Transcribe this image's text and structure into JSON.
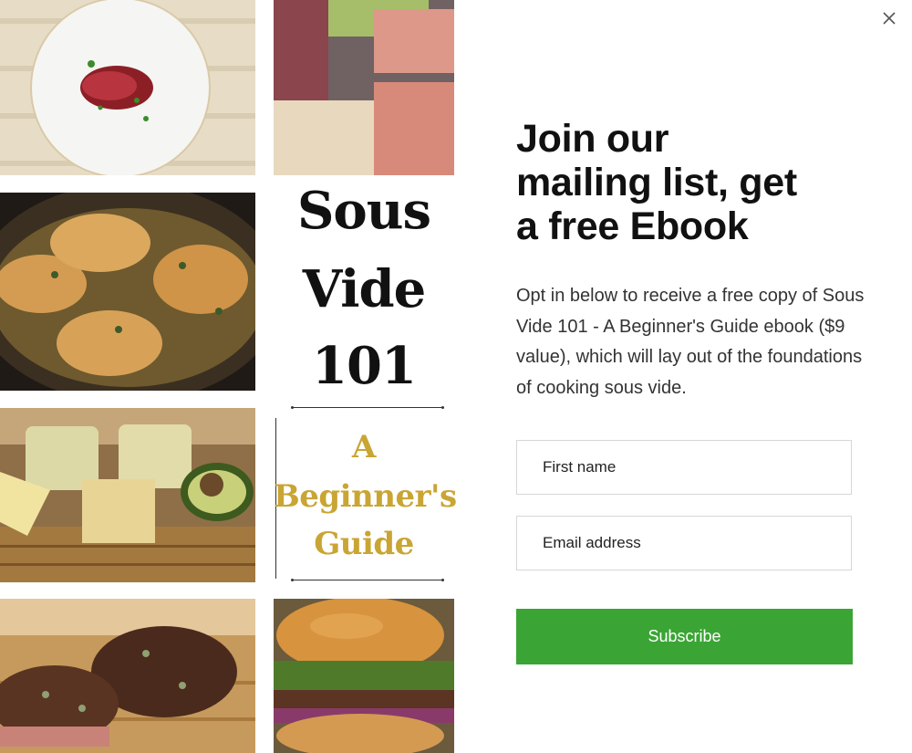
{
  "modal": {
    "close_icon": "close-icon"
  },
  "book_cover": {
    "title_line1": "Sous",
    "title_line2": "Vide",
    "title_line3": "101",
    "subtitle_line1": "A",
    "subtitle_line2": "Beginner's",
    "subtitle_line3": "Guide"
  },
  "form": {
    "headline_line1": "Join our",
    "headline_line2": "mailing list, get",
    "headline_line3": "a free Ebook",
    "body": "Opt in below to receive a free copy of Sous Vide 101 - A Beginner's Guide ebook ($9 value), which will lay out of the foundations of cooking sous vide.",
    "first_name_placeholder": "First name",
    "first_name_value": "",
    "email_placeholder": "Email address",
    "email_value": "",
    "subscribe_label": "Subscribe"
  },
  "colors": {
    "subscribe_green": "#3aa535",
    "subtitle_gold": "#c9a534"
  }
}
